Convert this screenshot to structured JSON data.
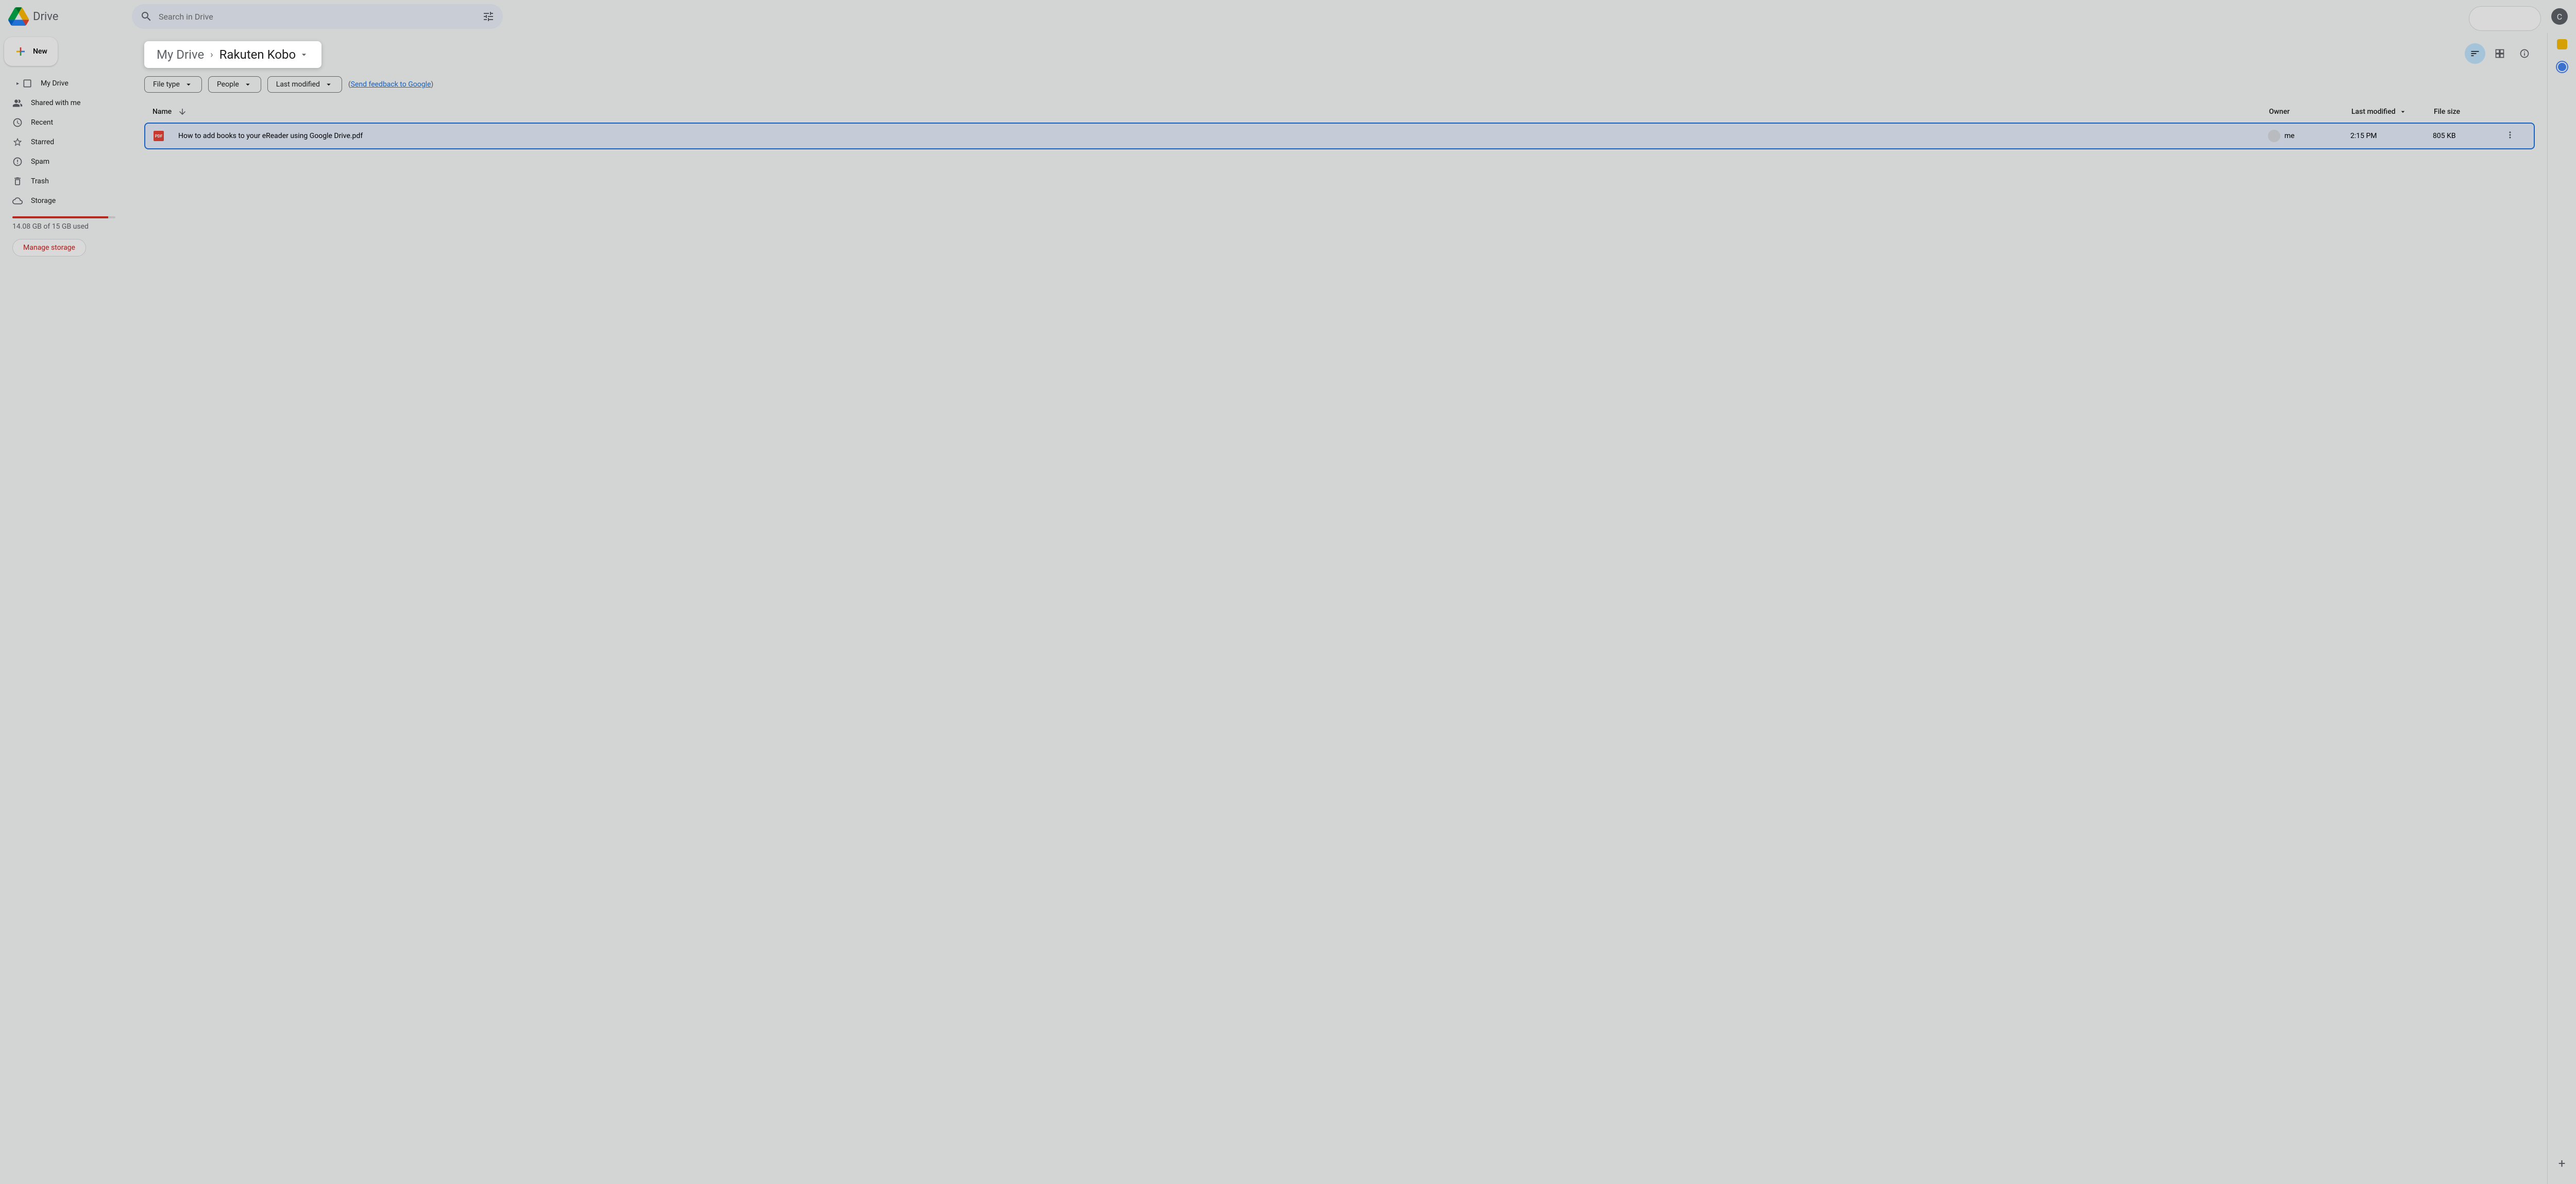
{
  "header": {
    "app_name": "Drive",
    "search_placeholder": "Search in Drive",
    "avatar_letter": "C"
  },
  "sidebar": {
    "new_label": "New",
    "items": [
      {
        "label": "My Drive"
      },
      {
        "label": "Shared with me"
      },
      {
        "label": "Recent"
      },
      {
        "label": "Starred"
      },
      {
        "label": "Spam"
      },
      {
        "label": "Trash"
      },
      {
        "label": "Storage"
      }
    ],
    "storage_text": "14.08 GB of 15 GB used",
    "manage_label": "Manage storage"
  },
  "breadcrumb": {
    "parent": "My Drive",
    "current": "Rakuten Kobo"
  },
  "filters": {
    "type": "File type",
    "people": "People",
    "modified": "Last modified",
    "feedback": "Send feedback to Google"
  },
  "table": {
    "headers": {
      "name": "Name",
      "owner": "Owner",
      "modified": "Last modified",
      "size": "File size"
    },
    "rows": [
      {
        "name": "How to add books to your eReader using Google Drive.pdf",
        "owner": "me",
        "modified": "2:15 PM",
        "size": "805 KB"
      }
    ]
  }
}
